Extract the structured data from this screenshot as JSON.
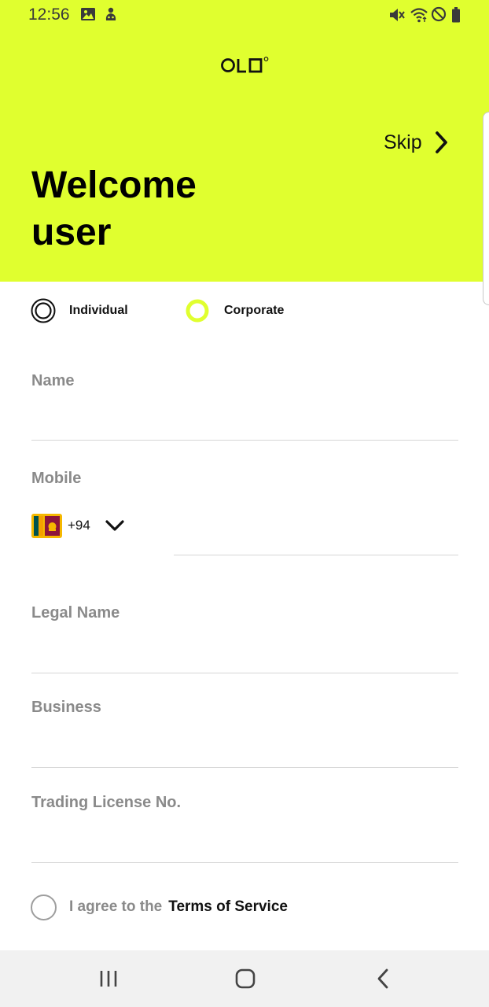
{
  "status_bar": {
    "time": "12:56",
    "icons": [
      "image-icon",
      "notification-app-icon",
      "mute-icon",
      "wifi-icon",
      "do-not-disturb-icon",
      "battery-icon"
    ]
  },
  "header": {
    "logo": "OLO",
    "skip_label": "Skip",
    "welcome_line1": "Welcome",
    "welcome_line2": "user",
    "background_color": "#e0ff2f"
  },
  "account_type": {
    "options": [
      {
        "label": "Individual",
        "selected": true
      },
      {
        "label": "Corporate",
        "selected": false
      }
    ],
    "accent_color": "#e0ff2f"
  },
  "form": {
    "name": {
      "label": "Name",
      "value": ""
    },
    "mobile": {
      "label": "Mobile",
      "dial_code": "+94",
      "country_flag": "sri-lanka-flag-icon",
      "value": ""
    },
    "legal_name": {
      "label": "Legal Name",
      "value": ""
    },
    "business": {
      "label": "Business",
      "value": ""
    },
    "trading_license": {
      "label": "Trading License No.",
      "value": ""
    }
  },
  "agreement": {
    "text": "I agree to the",
    "link": "Terms of Service",
    "checked": false
  },
  "nav_bar": {
    "buttons": [
      "recent-apps-icon",
      "home-icon",
      "back-icon"
    ]
  }
}
